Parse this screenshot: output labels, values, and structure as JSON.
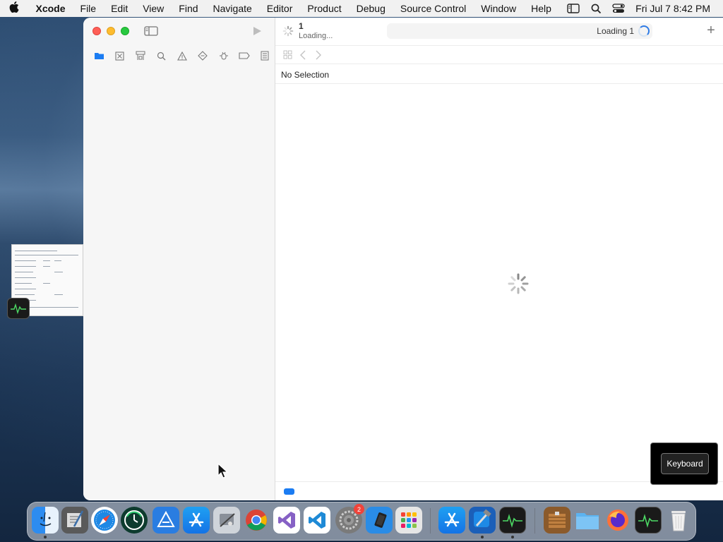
{
  "menubar": {
    "app_name": "Xcode",
    "menus": [
      "File",
      "Edit",
      "View",
      "Find",
      "Navigate",
      "Editor",
      "Product",
      "Debug",
      "Source Control",
      "Window",
      "Help"
    ],
    "clock": "Fri Jul 7  8:42 PM",
    "status_icons": [
      "sidebar-icon",
      "search-icon",
      "control-center-icon"
    ]
  },
  "toolbar": {
    "scheme_name": "1",
    "scheme_status": "Loading...",
    "activity_text": "Loading 1"
  },
  "editor": {
    "selection_label": "No Selection"
  },
  "navigator": {
    "icons": [
      "folder-icon",
      "source-control-icon",
      "symbol-icon",
      "find-icon",
      "issue-icon",
      "test-icon",
      "debug-icon",
      "breakpoint-icon",
      "report-icon"
    ]
  },
  "overlay": {
    "keyboard_label": "Keyboard"
  },
  "dock": {
    "badge_count": "2",
    "apps": [
      "Finder",
      "Script Editor",
      "Safari",
      "Time Machine",
      "Acrobat",
      "App Store",
      "System Information",
      "Chrome",
      "Visual Studio",
      "VS Code",
      "System Preferences",
      "Simulator",
      "Launchpad",
      "App Store",
      "Xcode",
      "Activity Monitor",
      "Archive Utility",
      "Folder",
      "Firefox",
      "Activity Monitor",
      "Trash"
    ]
  },
  "colors": {
    "accent": "#2f7be5",
    "close": "#fe5f57",
    "minimize": "#febc2e",
    "maximize": "#28c840"
  }
}
